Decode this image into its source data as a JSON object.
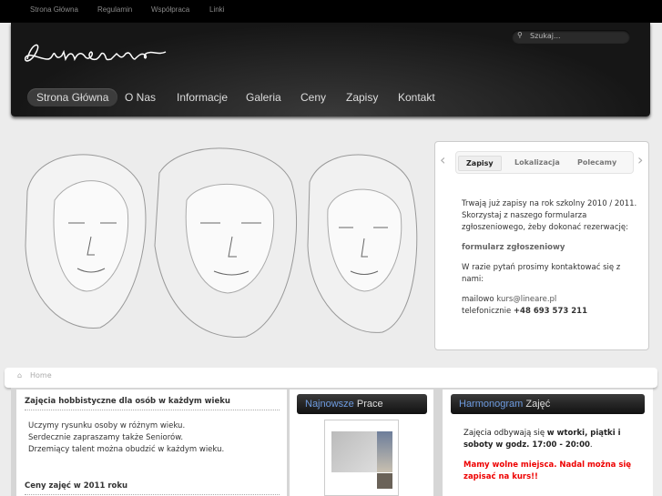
{
  "topbar": {
    "links": [
      "Strona Główna",
      "Regulamin",
      "Współpraca",
      "Linki"
    ]
  },
  "header": {
    "logo": "Lineare",
    "search_placeholder": "Szukaj..."
  },
  "nav": {
    "items": [
      "Strona Główna",
      "O Nas",
      "Informacje",
      "Galeria",
      "Ceny",
      "Zapisy",
      "Kontakt"
    ],
    "active": 0
  },
  "tabs": {
    "items": [
      "Zapisy",
      "Lokalizacja",
      "Polecamy"
    ],
    "active": 0,
    "content": {
      "p1": "Trwają już zapisy na rok szkolny 2010 / 2011. Skorzystaj z naszego formularza zgłoszeniowego, żeby dokonać rezerwację:",
      "link": "formularz zgłoszeniowy",
      "p2": "W razie pytań prosimy kontaktować się z nami:",
      "mail_label": "mailowo ",
      "mail": "kurs@lineare.pl",
      "phone_label": "telefonicznie ",
      "phone": "+48 693 573 211"
    }
  },
  "breadcrumb": {
    "home": "Home"
  },
  "left": {
    "title": "Zajęcia hobbistyczne dla osób w każdym wieku",
    "lines": [
      "Uczymy rysunku osoby w różnym wieku.",
      "Serdecznie zapraszamy także Seniorów.",
      "Drzemiący talent można obudzić w każdym wieku."
    ],
    "title2": "Ceny zajęć w 2011 roku"
  },
  "middle": {
    "title_hl": "Najnowsze",
    "title": " Prace"
  },
  "right": {
    "title_hl": "Harmonogram",
    "title": " Zajęć",
    "text1": "Zajęcia odbywają się ",
    "text1b": "w wtorki, piątki i soboty w godz. 17:00 - 20:00",
    "text1c": ".",
    "alert": "Mamy wolne miejsca. Nadal można się zapisać na kurs!!"
  }
}
